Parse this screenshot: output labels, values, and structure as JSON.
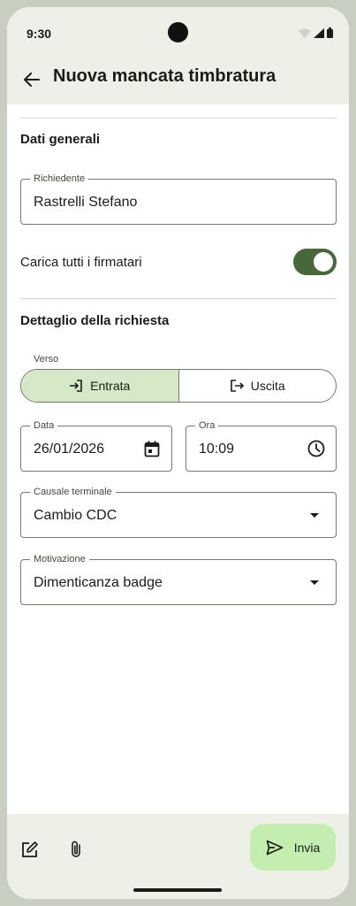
{
  "status_bar": {
    "time": "9:30"
  },
  "header": {
    "title": "Nuova mancata timbratura",
    "back_icon": "arrow-back-icon"
  },
  "general": {
    "section_title": "Dati generali",
    "requester": {
      "label": "Richiedente",
      "value": "Rastrelli Stefano"
    },
    "load_signers": {
      "label": "Carica tutti i firmatari",
      "checked": true
    }
  },
  "detail": {
    "section_title": "Dettaglio della richiesta",
    "direction": {
      "caption": "Verso",
      "options": [
        {
          "label": "Entrata",
          "selected": true,
          "icon": "login-icon"
        },
        {
          "label": "Uscita",
          "selected": false,
          "icon": "logout-icon"
        }
      ]
    },
    "date": {
      "label": "Data",
      "value": "26/01/2026",
      "icon": "calendar-icon"
    },
    "time": {
      "label": "Ora",
      "value": "10:09",
      "icon": "clock-icon"
    },
    "terminal_reason": {
      "label": "Causale terminale",
      "value": "Cambio CDC"
    },
    "reason": {
      "label": "Motivazione",
      "value": "Dimenticanza badge"
    }
  },
  "bottom_bar": {
    "edit_icon": "edit-note-icon",
    "attach_icon": "attach-icon",
    "send_label": "Invia",
    "send_icon": "send-icon"
  },
  "colors": {
    "accent": "#46683a",
    "selected_segment": "#d5e8c8",
    "fab": "#c4eeb0",
    "surface": "#eef0e8"
  }
}
